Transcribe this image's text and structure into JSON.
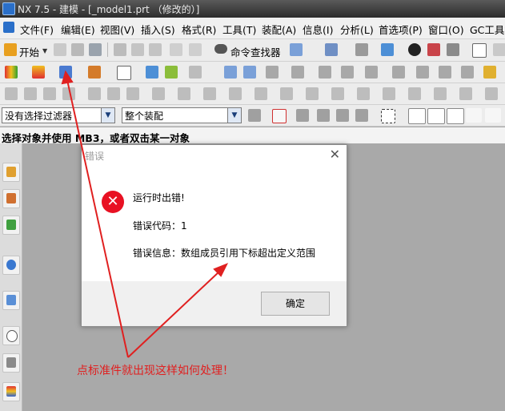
{
  "window": {
    "title": "NX 7.5 - 建模 - [_model1.prt （修改的）]"
  },
  "menu": [
    "文件(F)",
    "编辑(E)",
    "视图(V)",
    "插入(S)",
    "格式(R)",
    "工具(T)",
    "装配(A)",
    "信息(I)",
    "分析(L)",
    "首选项(P)",
    "窗口(O)",
    "GC工具箱"
  ],
  "toolbar": {
    "start_label": "开始",
    "command_finder_label": "命令查找器"
  },
  "filterbar": {
    "selection_filter": "没有选择过滤器",
    "scope": "整个装配"
  },
  "prompt": "选择对象并使用 MB3，或者双击某一对象",
  "dialog": {
    "title": "错误",
    "heading": "运行时出错!",
    "code_line": "错误代码：1",
    "message_line": "错误信息：数组成员引用下标超出定义范围",
    "ok_label": "确定"
  },
  "annotation": "点标准件就出现这样如何处理！",
  "colors": {
    "error_red": "#e81123",
    "annotation_red": "#e02020"
  }
}
